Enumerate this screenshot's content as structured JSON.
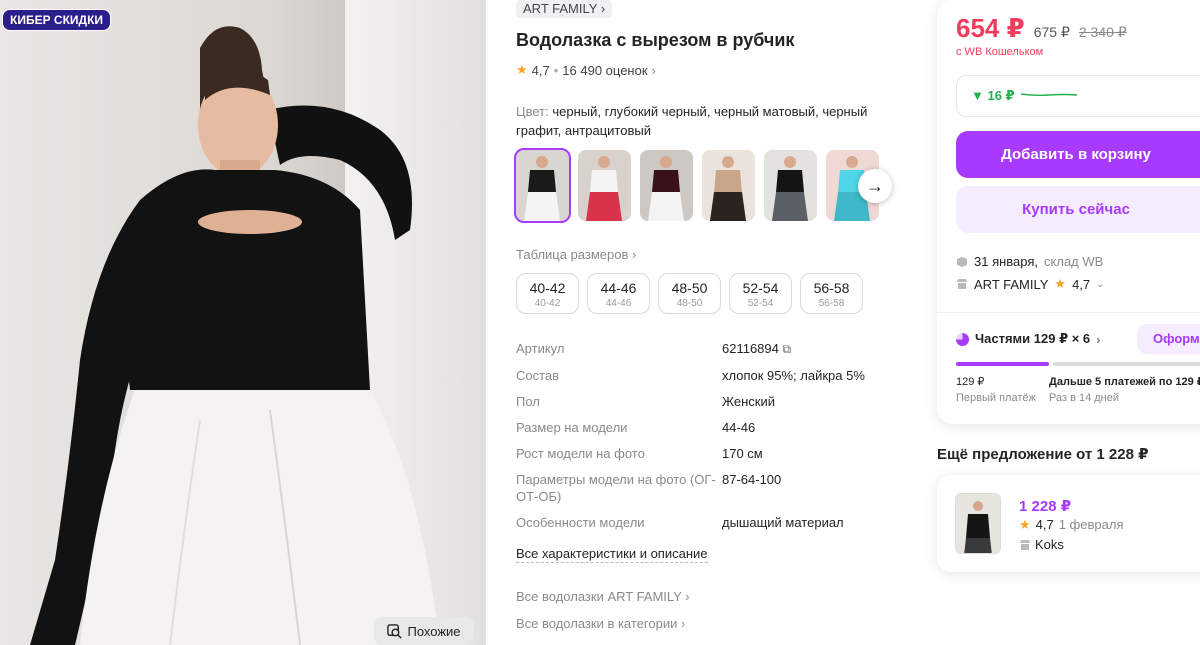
{
  "promo_badge": "КИБЕР СКИДКИ",
  "similar_button": "Похожие",
  "brand": "ART FAMILY",
  "title": "Водолазка с вырезом в рубчик",
  "rating": {
    "value": "4,7",
    "separator": "•",
    "reviews": "16 490 оценок"
  },
  "color": {
    "label": "Цвет:",
    "values": "черный, глубокий черный, черный матовый, черный графит, антрацитовый"
  },
  "thumbnails": [
    {
      "top": "#1a1a1a",
      "bottom": "#f4f4f4",
      "bg": "#d9d6d2"
    },
    {
      "top": "#f4f4f4",
      "bottom": "#d8334a",
      "bg": "#d8d2cc"
    },
    {
      "top": "#3a1118",
      "bottom": "#f4f4f4",
      "bg": "#cdc8c3"
    },
    {
      "top": "#c9a58a",
      "bottom": "#2b2320",
      "bg": "#ebe4dc"
    },
    {
      "top": "#141414",
      "bottom": "#5a6066",
      "bg": "#e4e2df"
    },
    {
      "top": "#4fd6e6",
      "bottom": "#3fb8c8",
      "bg": "#f0d8d4"
    }
  ],
  "size_table_link": "Таблица размеров",
  "sizes": [
    {
      "ru": "40-42",
      "alt": "40-42"
    },
    {
      "ru": "44-46",
      "alt": "44-46"
    },
    {
      "ru": "48-50",
      "alt": "48-50"
    },
    {
      "ru": "52-54",
      "alt": "52-54"
    },
    {
      "ru": "56-58",
      "alt": "56-58"
    }
  ],
  "specs": [
    {
      "key": "Артикул",
      "value": "62116894"
    },
    {
      "key": "Состав",
      "value": "хлопок 95%; лайкра 5%"
    },
    {
      "key": "Пол",
      "value": "Женский"
    },
    {
      "key": "Размер на модели",
      "value": "44-46"
    },
    {
      "key": "Рост модели на фото",
      "value": "170 см"
    },
    {
      "key": "Параметры модели на фото (ОГ-ОТ-ОБ)",
      "value": "87-64-100"
    },
    {
      "key": "Особенности модели",
      "value": "дышащий материал"
    }
  ],
  "all_characteristics": "Все характеристики и описание",
  "links": {
    "brand_all": "Все водолазки ART FAMILY",
    "category_all": "Все водолазки в категории"
  },
  "price": {
    "current": "654 ₽",
    "without_wallet": "675 ₽",
    "old": "2 340 ₽",
    "wallet_note": "с WB Кошельком"
  },
  "price_trend": {
    "text": "▼ 16 ₽"
  },
  "buttons": {
    "add_to_cart": "Добавить в корзину",
    "buy_now": "Купить сейчас"
  },
  "delivery": {
    "date": "31 января,",
    "warehouse": "склад WB"
  },
  "seller": {
    "name": "ART FAMILY",
    "rating": "4,7"
  },
  "installments": {
    "label": "Частями 129 ₽ × 6",
    "button": "Оформ",
    "progress": 0.38,
    "first_amount": "129 ₽",
    "first_label": "Первый платёж",
    "rest_label": "Дальше 5 платежей по 129 ₽",
    "rest_sub": "Раз в 14 дней"
  },
  "more_offer": {
    "heading": "Ещё предложение от 1 228 ₽",
    "price": "1 228 ₽",
    "rating": "4,7",
    "date": "1 февраля",
    "seller": "Koks"
  },
  "colors": {
    "accent": "#a73afd",
    "price": "#f23c5c",
    "green": "#22b14c",
    "star": "#f5a623"
  }
}
